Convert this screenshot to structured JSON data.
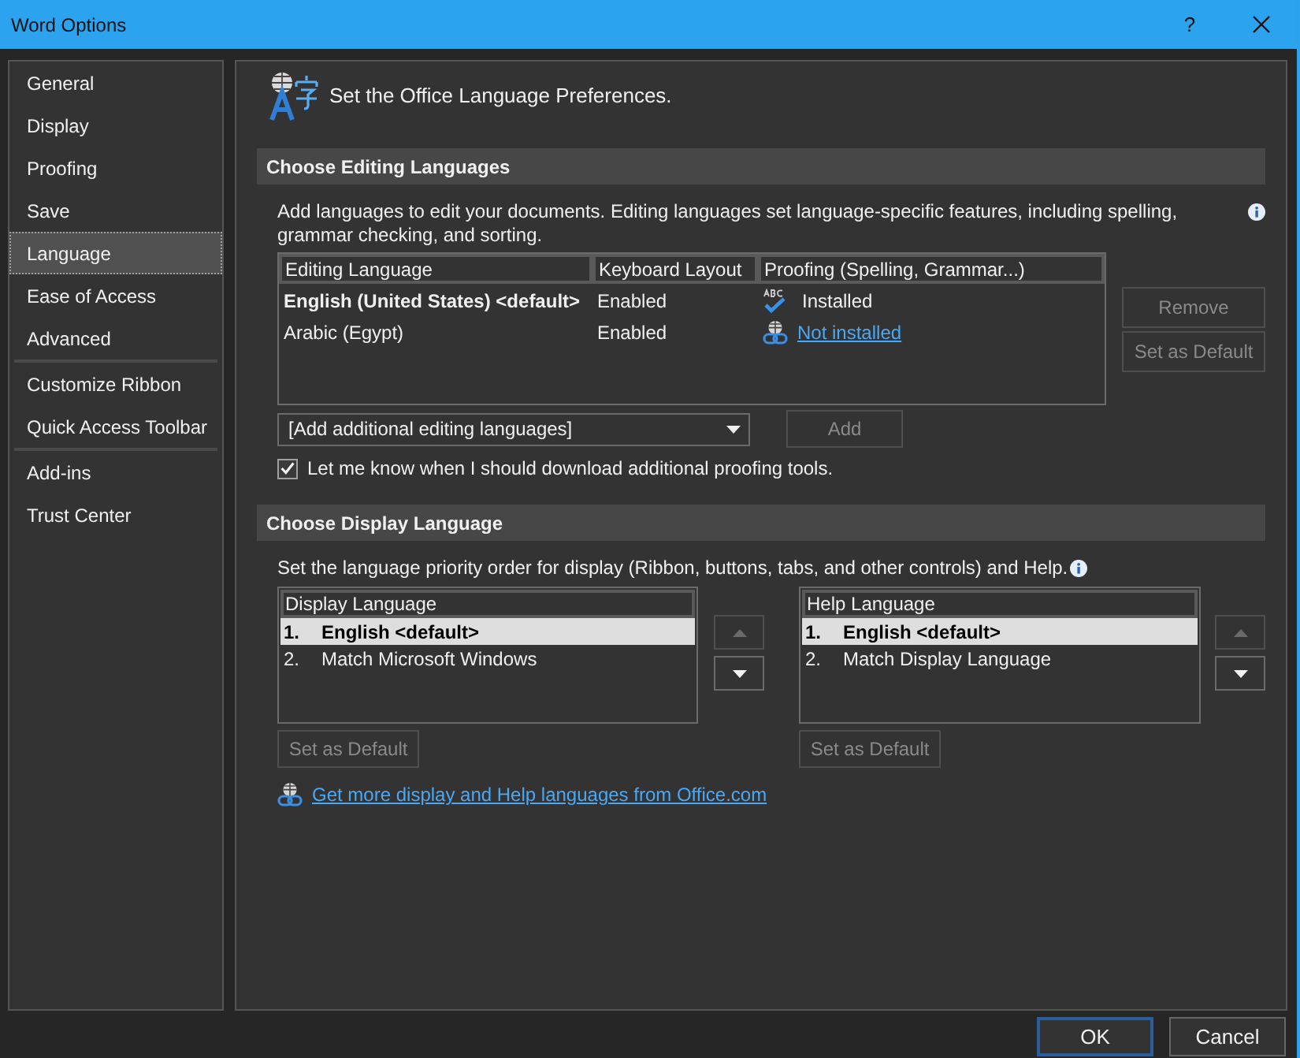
{
  "window": {
    "title": "Word Options",
    "help_button": "?"
  },
  "sidebar": {
    "groups": [
      {
        "items": [
          {
            "label": "General",
            "selected": false
          },
          {
            "label": "Display",
            "selected": false
          },
          {
            "label": "Proofing",
            "selected": false
          },
          {
            "label": "Save",
            "selected": false
          },
          {
            "label": "Language",
            "selected": true
          },
          {
            "label": "Ease of Access",
            "selected": false
          },
          {
            "label": "Advanced",
            "selected": false
          }
        ]
      },
      {
        "items": [
          {
            "label": "Customize Ribbon",
            "selected": false
          },
          {
            "label": "Quick Access Toolbar",
            "selected": false
          }
        ]
      },
      {
        "items": [
          {
            "label": "Add-ins",
            "selected": false
          },
          {
            "label": "Trust Center",
            "selected": false
          }
        ]
      }
    ]
  },
  "page_header": {
    "title": "Set the Office Language Preferences."
  },
  "editing_section": {
    "title": "Choose Editing Languages",
    "description": "Add languages to edit your documents. Editing languages set language-specific features, including spelling, grammar checking, and sorting.",
    "table": {
      "columns": [
        "Editing Language",
        "Keyboard Layout",
        "Proofing (Spelling, Grammar...)"
      ],
      "rows": [
        {
          "language": "English (United States) <default>",
          "is_default": true,
          "keyboard_layout": "Enabled",
          "proofing": {
            "kind": "installed",
            "text": "Installed"
          }
        },
        {
          "language": "Arabic (Egypt)",
          "is_default": false,
          "keyboard_layout": "Enabled",
          "proofing": {
            "kind": "link",
            "text": "Not installed"
          }
        }
      ]
    },
    "side_buttons": [
      {
        "label": "Remove",
        "disabled": true
      },
      {
        "label": "Set as Default",
        "disabled": true
      }
    ],
    "language_dropdown": {
      "value": "[Add additional editing languages]"
    },
    "add_button": {
      "label": "Add",
      "disabled": true
    },
    "notify_checkbox": {
      "label": "Let me know when I should download additional proofing tools.",
      "checked": true
    }
  },
  "display_section": {
    "title": "Choose Display Language",
    "description": "Set the language priority order for display (Ribbon, buttons, tabs, and other controls) and Help.",
    "lists": [
      {
        "heading": "Display Language",
        "items": [
          {
            "number": "1.",
            "label": "English <default>",
            "selected": true
          },
          {
            "number": "2.",
            "label": "Match Microsoft Windows",
            "selected": false
          }
        ],
        "move_buttons": [
          {
            "kind": "up",
            "disabled": true
          },
          {
            "kind": "down",
            "disabled": false
          }
        ],
        "set_default_button": {
          "label": "Set as Default",
          "disabled": true
        }
      },
      {
        "heading": "Help Language",
        "items": [
          {
            "number": "1.",
            "label": "English <default>",
            "selected": true
          },
          {
            "number": "2.",
            "label": "Match Display Language",
            "selected": false
          }
        ],
        "move_buttons": [
          {
            "kind": "up",
            "disabled": true
          },
          {
            "kind": "down",
            "disabled": false
          }
        ],
        "set_default_button": {
          "label": "Set as Default",
          "disabled": true
        }
      }
    ],
    "link": "Get more display and Help languages from Office.com"
  },
  "footer_buttons": [
    {
      "label": "OK",
      "focused": true
    },
    {
      "label": "Cancel",
      "focused": false
    }
  ]
}
